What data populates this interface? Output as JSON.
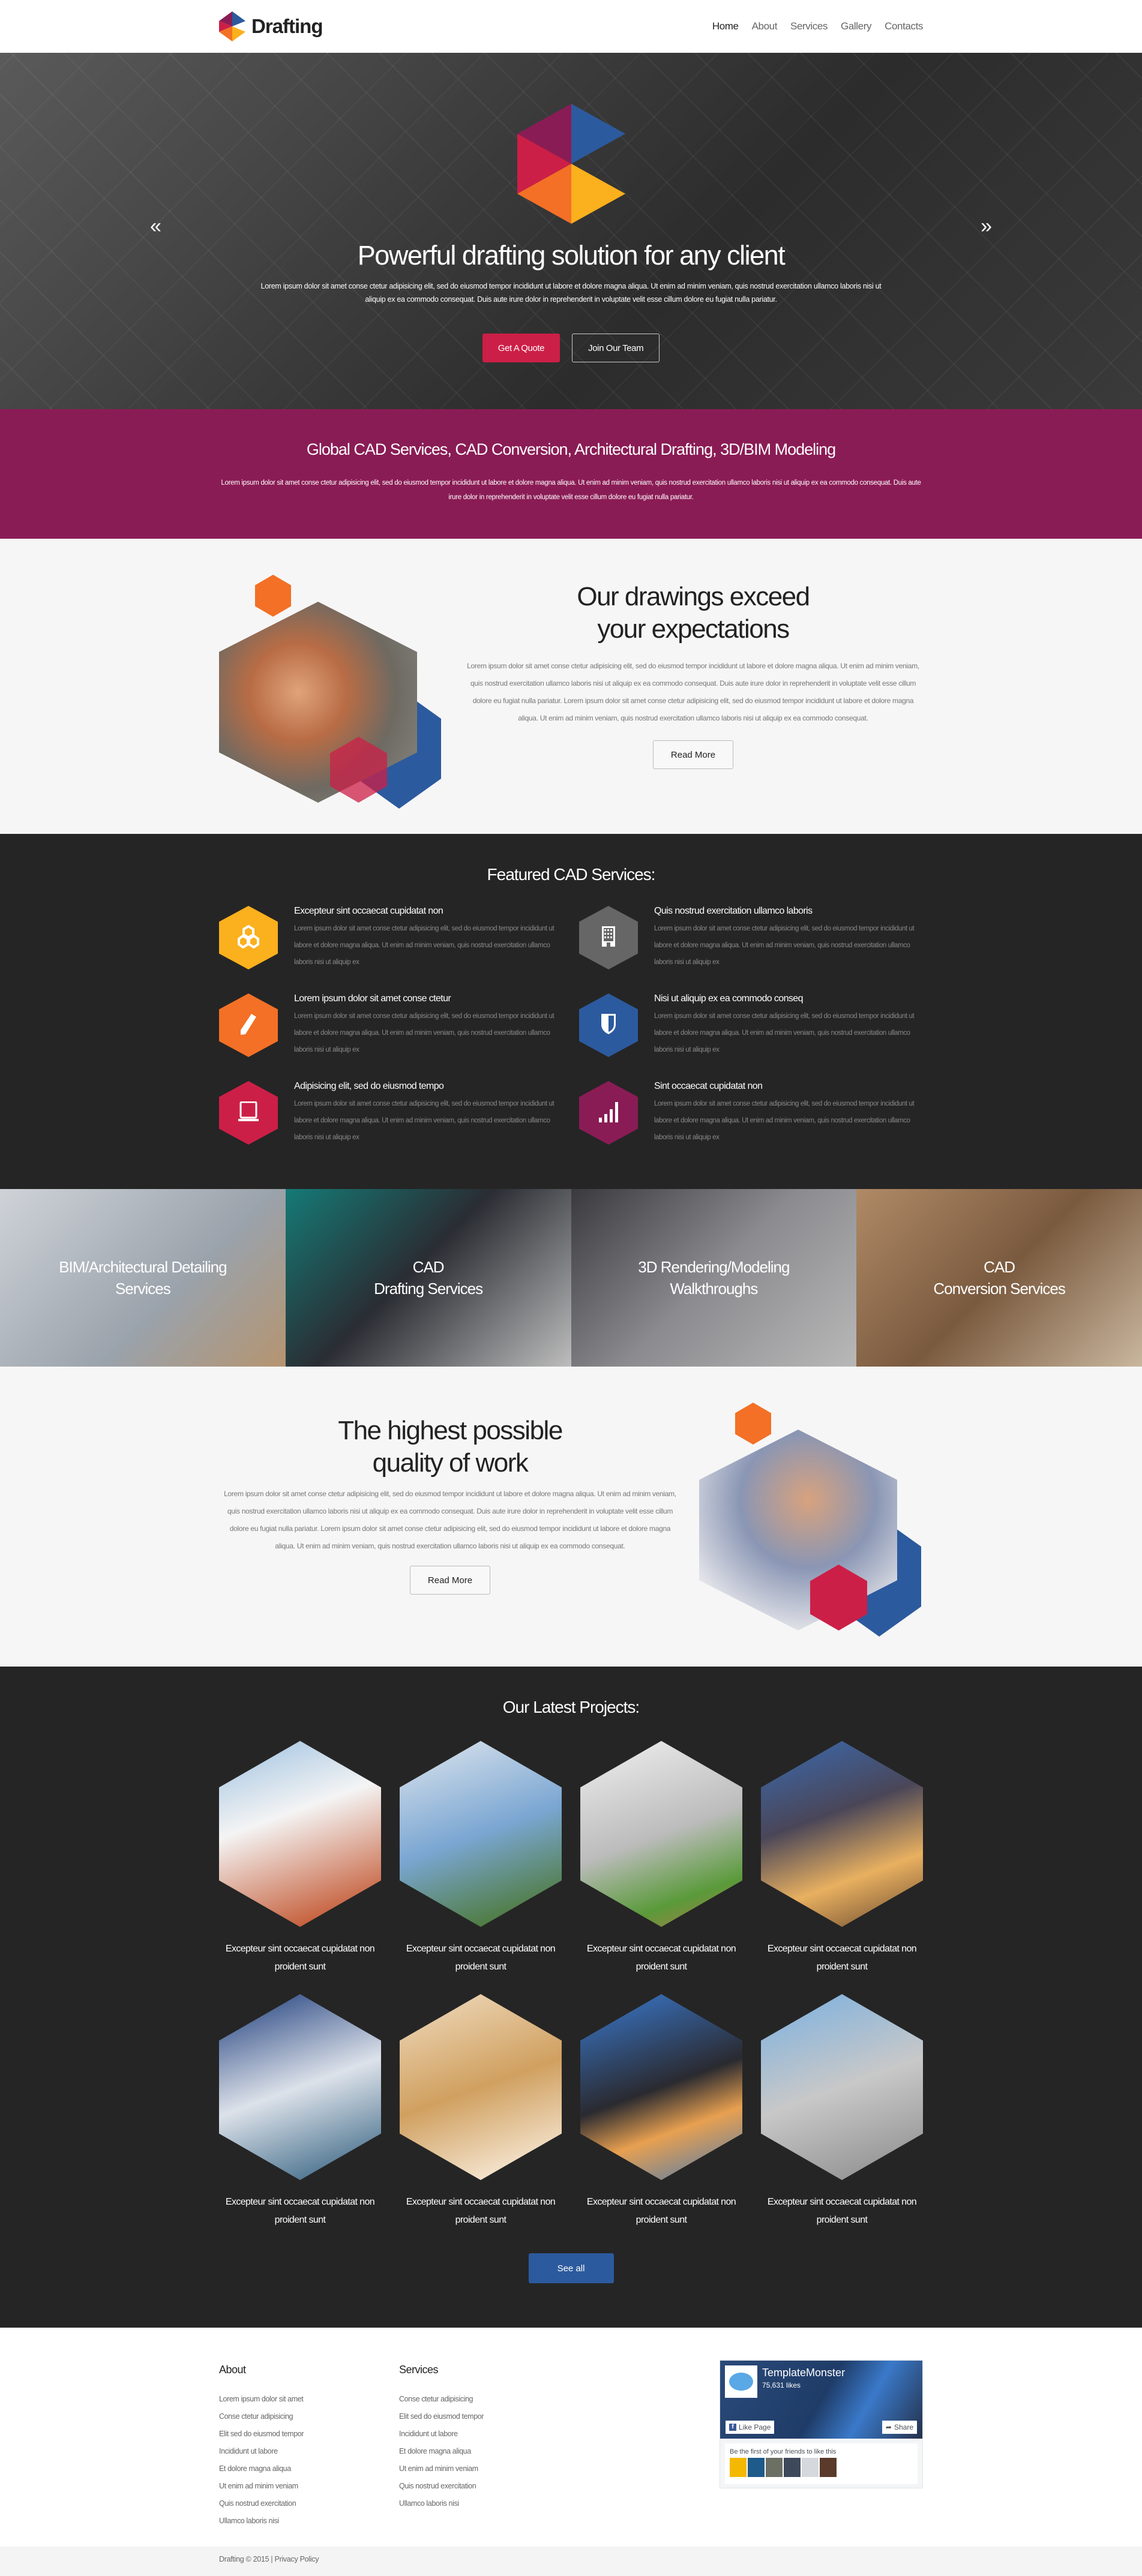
{
  "header": {
    "logo_text": "Drafting",
    "nav": [
      {
        "label": "Home",
        "active": true
      },
      {
        "label": "About"
      },
      {
        "label": "Services"
      },
      {
        "label": "Gallery"
      },
      {
        "label": "Contacts"
      }
    ]
  },
  "hero": {
    "title": "Powerful drafting solution for any client",
    "text": "Lorem ipsum dolor sit amet conse ctetur adipisicing elit, sed do eiusmod tempor incididunt ut labore et dolore magna aliqua. Ut enim ad minim veniam, quis nostrud exercitation ullamco laboris nisi ut aliquip ex ea commodo consequat. Duis aute irure dolor in reprehenderit in voluptate velit esse cillum dolore eu fugiat nulla pariatur.",
    "primary_button": "Get A Quote",
    "secondary_button": "Join Our Team",
    "prev_arrow": "«",
    "next_arrow": "»"
  },
  "band": {
    "title": "Global CAD Services, CAD Conversion, Architectural Drafting, 3D/BIM Modeling",
    "text": "Lorem ipsum dolor sit amet conse ctetur adipisicing elit, sed do eiusmod tempor incididunt ut labore et dolore magna aliqua. Ut enim ad minim veniam, quis nostrud exercitation ullamco laboris nisi ut aliquip ex ea commodo consequat. Duis aute irure dolor in reprehenderit in voluptate velit esse cillum dolore eu fugiat nulla pariatur."
  },
  "about": {
    "title": "Our drawings exceed your expectations",
    "text": "Lorem ipsum dolor sit amet conse ctetur adipisicing elit, sed do eiusmod tempor incididunt ut labore et dolore magna aliqua. Ut enim ad minim veniam, quis nostrud exercitation ullamco laboris nisi ut aliquip ex ea commodo consequat. Duis aute irure dolor in reprehenderit in voluptate velit esse cillum dolore eu fugiat nulla pariatur. Lorem ipsum dolor sit amet conse ctetur adipisicing elit, sed do eiusmod tempor incididunt ut labore et dolore magna aliqua. Ut enim ad minim veniam, quis nostrud exercitation ullamco laboris nisi ut aliquip ex ea commodo consequat.",
    "button": "Read More"
  },
  "featured": {
    "title": "Featured CAD Services:",
    "items": [
      {
        "title": "Excepteur sint occaecat cupidatat non",
        "text": "Lorem ipsum dolor sit amet conse ctetur adipisicing elit, sed do eiusmod tempor incididunt ut labore et dolore magna aliqua. Ut enim ad minim veniam, quis nostrud exercitation ullamco laboris nisi ut aliquip ex",
        "icon": "cubes-icon",
        "color": "#fbb01d"
      },
      {
        "title": "Quis nostrud exercitation ullamco laboris",
        "text": "Lorem ipsum dolor sit amet conse ctetur adipisicing elit, sed do eiusmod tempor incididunt ut labore et dolore magna aliqua. Ut enim ad minim veniam, quis nostrud exercitation ullamco laboris nisi ut aliquip ex",
        "icon": "building-icon",
        "color": "#666666"
      },
      {
        "title": "Lorem ipsum dolor sit amet conse ctetur",
        "text": "Lorem ipsum dolor sit amet conse ctetur adipisicing elit, sed do eiusmod tempor incididunt ut labore et dolore magna aliqua. Ut enim ad minim veniam, quis nostrud exercitation ullamco laboris nisi ut aliquip ex",
        "icon": "pencil-icon",
        "color": "#f37026"
      },
      {
        "title": "Nisi ut aliquip ex ea commodo conseq",
        "text": "Lorem ipsum dolor sit amet conse ctetur adipisicing elit, sed do eiusmod tempor incididunt ut labore et dolore magna aliqua. Ut enim ad minim veniam, quis nostrud exercitation ullamco laboris nisi ut aliquip ex",
        "icon": "shield-icon",
        "color": "#2c5a9e"
      },
      {
        "title": "Adipisicing elit, sed do eiusmod tempo",
        "text": "Lorem ipsum dolor sit amet conse ctetur adipisicing elit, sed do eiusmod tempor incididunt ut labore et dolore magna aliqua. Ut enim ad minim veniam, quis nostrud exercitation ullamco laboris nisi ut aliquip ex",
        "icon": "laptop-icon",
        "color": "#cc1f47"
      },
      {
        "title": "Sint occaecat cupidatat non",
        "text": "Lorem ipsum dolor sit amet conse ctetur adipisicing elit, sed do eiusmod tempor incididunt ut labore et dolore magna aliqua. Ut enim ad minim veniam, quis nostrud exercitation ullamco laboris nisi ut aliquip ex",
        "icon": "signal-bars-icon",
        "color": "#8a1c55"
      }
    ]
  },
  "tiles": [
    {
      "line1": "BIM/Architectural Detailing",
      "line2": "Services"
    },
    {
      "line1": "CAD",
      "line2": "Drafting Services"
    },
    {
      "line1": "3D Rendering/Modeling",
      "line2": "Walkthroughs"
    },
    {
      "line1": "CAD",
      "line2": "Conversion Services"
    }
  ],
  "quality": {
    "title": "The highest possible quality of work",
    "text": "Lorem ipsum dolor sit amet conse ctetur adipisicing elit, sed do eiusmod tempor incididunt ut labore et dolore magna aliqua. Ut enim ad minim veniam, quis nostrud exercitation ullamco laboris nisi ut aliquip ex ea commodo consequat. Duis aute irure dolor in reprehenderit in voluptate velit esse cillum dolore eu fugiat nulla pariatur. Lorem ipsum dolor sit amet conse ctetur adipisicing elit, sed do eiusmod tempor incididunt ut labore et dolore magna aliqua. Ut enim ad minim veniam, quis nostrud exercitation ullamco laboris nisi ut aliquip ex ea commodo consequat.",
    "button": "Read More"
  },
  "projects": {
    "title": "Our Latest Projects:",
    "items": [
      {
        "caption": "Excepteur sint occaecat cupidatat non proident sunt"
      },
      {
        "caption": "Excepteur sint occaecat cupidatat non proident sunt"
      },
      {
        "caption": "Excepteur sint occaecat cupidatat non proident sunt"
      },
      {
        "caption": "Excepteur sint occaecat cupidatat non proident sunt"
      },
      {
        "caption": "Excepteur sint occaecat cupidatat non proident sunt"
      },
      {
        "caption": "Excepteur sint occaecat cupidatat non proident sunt"
      },
      {
        "caption": "Excepteur sint occaecat cupidatat non proident sunt"
      },
      {
        "caption": "Excepteur sint occaecat cupidatat non proident sunt"
      }
    ],
    "button": "See all"
  },
  "footer": {
    "about": {
      "title": "About",
      "links": [
        "Lorem ipsum dolor sit amet",
        "Conse ctetur adipisicing",
        "Elit sed do eiusmod tempor",
        "Incididunt ut labore",
        "Et dolore magna aliqua",
        "Ut enim ad minim veniam",
        "Quis nostrud exercitation",
        "Ullamco laboris nisi"
      ]
    },
    "services": {
      "title": "Services",
      "links": [
        "Conse ctetur adipisicing",
        "Elit sed do eiusmod tempor",
        "Incididunt ut labore",
        "Et dolore magna aliqua",
        "Ut enim ad minim veniam",
        "Quis nostrud exercitation",
        "Ullamco laboris nisi"
      ]
    },
    "facebook": {
      "page_name": "TemplateMonster",
      "likes": "75,631 likes",
      "like_button": "Like Page",
      "share_button": "Share",
      "friends_text": "Be the first of your friends to like this"
    },
    "copyright": "Drafting © 2015 |",
    "privacy": "Privacy Policy"
  },
  "colors": {
    "purple": "#8a1c55",
    "red": "#cc1f47",
    "orange": "#f37026",
    "yellow": "#fbb01d",
    "blue": "#2c5a9e",
    "dark": "#252525"
  }
}
